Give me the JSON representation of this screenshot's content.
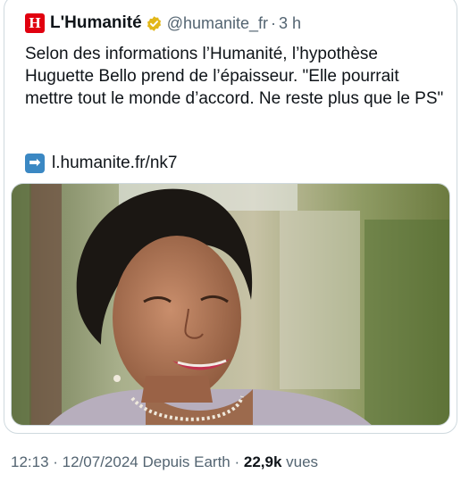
{
  "tweet": {
    "display_name": "L'Humanité",
    "logo_letter": "H",
    "handle": "@humanite_fr",
    "separator": "·",
    "age": "3 h",
    "text": "Selon des informations l’Humanité, l’hypothèse Huguette Bello prend de l’épaisseur. \"Elle pourrait mettre tout le monde d’accord. Ne reste plus que le PS\"",
    "link_icon": "right-arrow-icon",
    "link": "l.humanite.fr/nk7"
  },
  "meta": {
    "time": "12:13",
    "separator1": " · ",
    "date": "12/07/2024",
    "source": " Depuis Earth",
    "separator2": " · ",
    "views_count": "22,9k",
    "views_label": " vues"
  },
  "colors": {
    "brand_red": "#e1000f",
    "verified_gold": "#e2b719",
    "text_primary": "#0f1419",
    "text_secondary": "#536471",
    "border": "#cfd9de"
  }
}
